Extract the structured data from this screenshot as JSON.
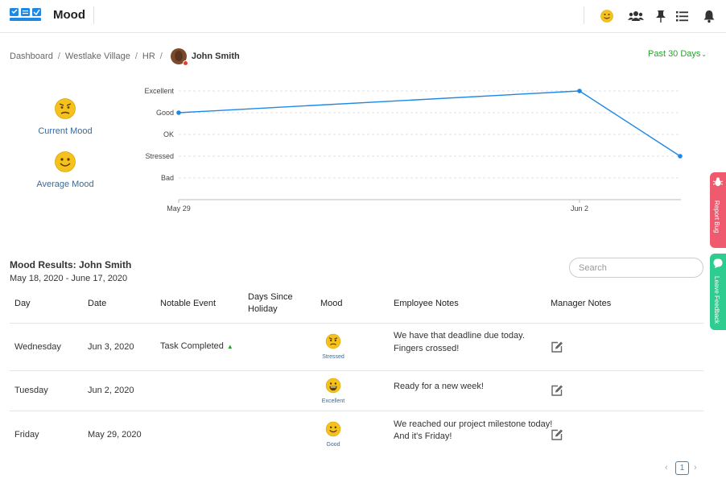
{
  "header": {
    "app_title": "Mood",
    "icons": [
      "mood-smiley-icon",
      "team-icon",
      "pin-icon",
      "list-icon",
      "bell-icon"
    ]
  },
  "breadcrumb": {
    "items": [
      "Dashboard",
      "Westlake Village",
      "HR"
    ],
    "separator": "/",
    "person": "John Smith"
  },
  "period": {
    "label": "Past 30 Days",
    "color": "#22a52a"
  },
  "summary": {
    "current_mood_label": "Current Mood",
    "current_mood_icon": "stressed-face-icon",
    "average_mood_label": "Average Mood",
    "average_mood_icon": "good-face-icon"
  },
  "chart_data": {
    "type": "line",
    "y_categories": [
      "Bad",
      "Stressed",
      "OK",
      "Good",
      "Excellent"
    ],
    "x_ticks": [
      "May 29",
      "Jun 2"
    ],
    "series": [
      {
        "points": [
          {
            "x": "May 29",
            "y": "Good"
          },
          {
            "x": "Jun 2",
            "y": "Excellent"
          },
          {
            "x": "Jun 3",
            "y": "Stressed"
          }
        ]
      }
    ],
    "grid": "dashed horizontal",
    "color": "#1e88e5"
  },
  "results": {
    "title": "Mood Results: John Smith",
    "range": "May 18, 2020 - June 17, 2020",
    "search_placeholder": "Search",
    "columns": [
      "Day",
      "Date",
      "Notable Event",
      "Days Since Holiday",
      "Mood",
      "Employee Notes",
      "Manager Notes"
    ],
    "rows": [
      {
        "day": "Wednesday",
        "date": "Jun 3, 2020",
        "event": "Task Completed",
        "event_icon": "triangle-up-icon",
        "days_since_holiday": "",
        "mood": "Stressed",
        "mood_icon": "stressed-face-icon",
        "notes_line1": "We have that deadline due today.",
        "notes_line2": "Fingers crossed!"
      },
      {
        "day": "Tuesday",
        "date": "Jun 2, 2020",
        "event": "",
        "days_since_holiday": "",
        "mood": "Excellent",
        "mood_icon": "excellent-face-icon",
        "notes_line1": "Ready for a new week!",
        "notes_line2": ""
      },
      {
        "day": "Friday",
        "date": "May 29, 2020",
        "event": "",
        "days_since_holiday": "",
        "mood": "Good",
        "mood_icon": "good-face-icon",
        "notes_line1": "We reached our project milestone today!",
        "notes_line2": "And it's Friday!"
      }
    ]
  },
  "side_tabs": {
    "report_bug": "Report Bug",
    "report_bug_color": "#ef5a6f",
    "leave_feedback": "Leave Feedback",
    "leave_feedback_color": "#2ecc8f"
  },
  "pagination": {
    "prev": "‹",
    "current": "1",
    "next": "›"
  }
}
